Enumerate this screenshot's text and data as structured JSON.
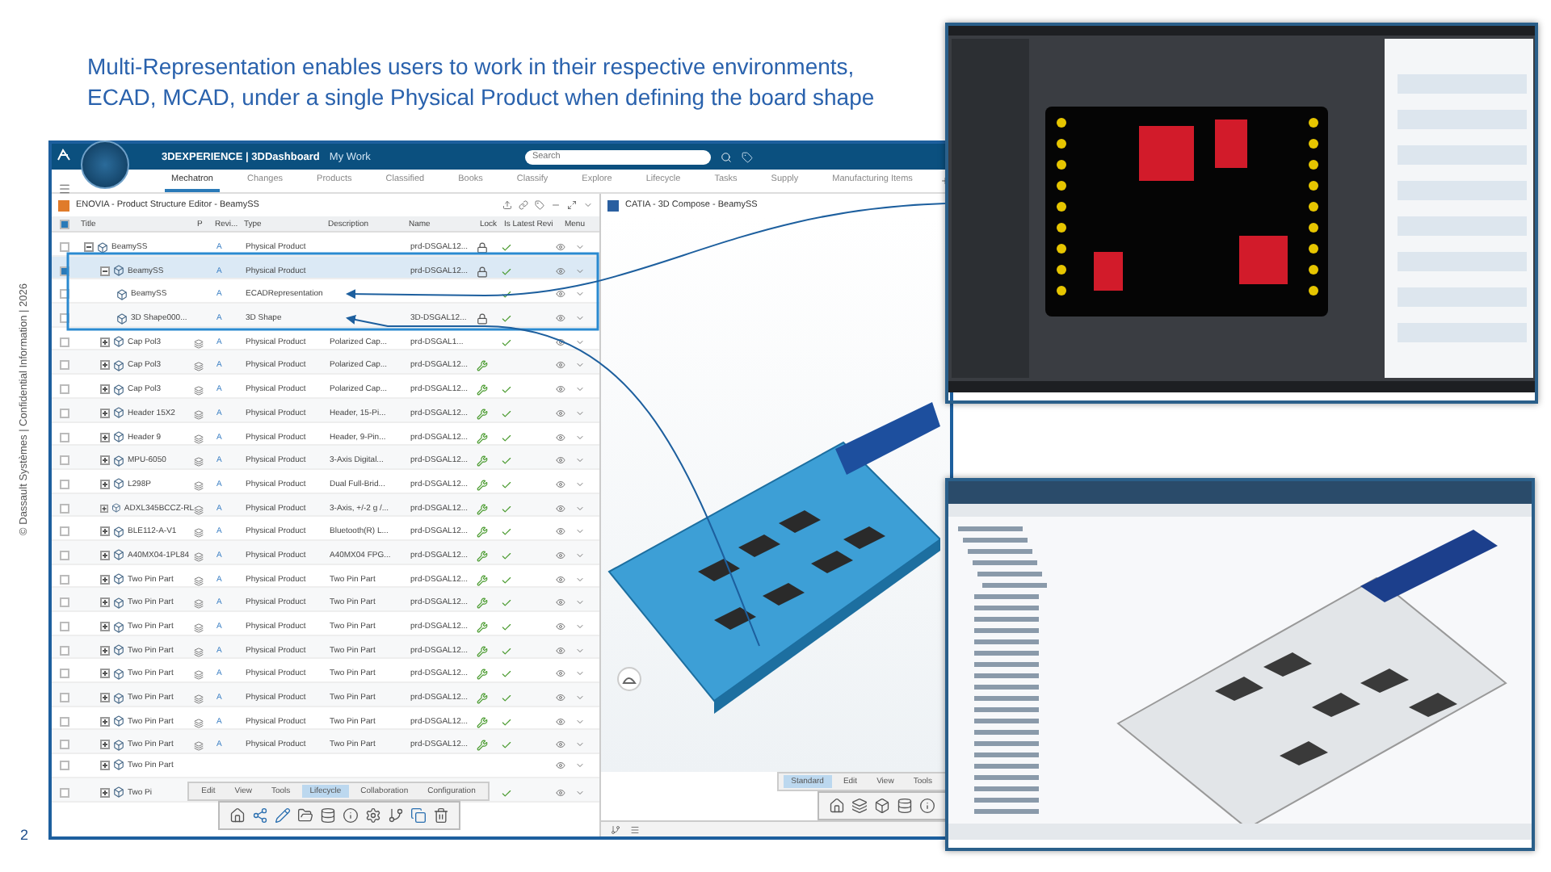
{
  "caption": "Multi-Representation enables users to work in their respective environments, ECAD, MCAD, under a single Physical Product when defining the board shape",
  "side_note": "© Dassault Systèmes | Confidential Information | 2026",
  "page_number": "2",
  "app": {
    "brand": "3DEXPERIENCE | 3DDashboard",
    "brand_sub": "My Work",
    "search": {
      "placeholder": "Search"
    },
    "tabs": [
      {
        "label": "Mechatron",
        "selected": true
      },
      {
        "label": "Changes",
        "selected": false
      },
      {
        "label": "Products",
        "selected": false
      },
      {
        "label": "Classified",
        "selected": false
      },
      {
        "label": "Books",
        "selected": false
      },
      {
        "label": "Classify",
        "selected": false
      },
      {
        "label": "Explore",
        "selected": false
      },
      {
        "label": "Lifecycle",
        "selected": false
      },
      {
        "label": "Tasks",
        "selected": false
      },
      {
        "label": "Supply",
        "selected": false
      },
      {
        "label": "Manufacturing Items",
        "selected": false
      }
    ]
  },
  "left_panel": {
    "title": "ENOVIA - Product Structure Editor - BeamySS",
    "select_all_checked": true,
    "columns": [
      "Title",
      "P",
      "Revi...",
      "Type",
      "Description",
      "Name",
      "Lock",
      "Is Latest Revi",
      "Menu"
    ],
    "rows": [
      {
        "title": "BeamySS",
        "rev": "A",
        "type": "Physical Product",
        "name": "prd-DSGAL12...",
        "locked": true,
        "reserved": false,
        "latest": true,
        "checked": false,
        "selected": false,
        "expanded": true,
        "children": [
          {
            "title": "BeamySS",
            "rev": "A",
            "type": "Physical Product",
            "name": "prd-DSGAL12...",
            "locked": true,
            "reserved": false,
            "latest": true,
            "checked": true,
            "selected": true,
            "expanded": true,
            "children": [
              {
                "title": "BeamySS",
                "rev": "A",
                "type": "ECADRepresentation",
                "locked": false,
                "reserved": false,
                "latest": true,
                "checked": false,
                "selected": false
              },
              {
                "title": "3D Shape000...",
                "rev": "A",
                "type": "3D Shape",
                "name": "3D-DSGAL12...",
                "locked": true,
                "reserved": false,
                "latest": true,
                "checked": false,
                "selected": false
              }
            ]
          },
          {
            "title": "Cap Pol3",
            "rev": "A",
            "type": "Physical Product",
            "description": "Polarized Cap...",
            "name": "prd-DSGAL1...",
            "locked": false,
            "reserved": false,
            "latest": true,
            "checked": false,
            "selected": false,
            "expanded": false
          },
          {
            "title": "Cap Pol3",
            "rev": "A",
            "type": "Physical Product",
            "description": "Polarized Cap...",
            "name": "prd-DSGAL12...",
            "locked": false,
            "reserved": true,
            "latest": false,
            "checked": false,
            "selected": false,
            "expanded": false
          },
          {
            "title": "Cap Pol3",
            "rev": "A",
            "type": "Physical Product",
            "description": "Polarized Cap...",
            "name": "prd-DSGAL12...",
            "locked": false,
            "reserved": true,
            "latest": true,
            "checked": false,
            "selected": false,
            "expanded": false
          },
          {
            "title": "Header 15X2",
            "rev": "A",
            "type": "Physical Product",
            "description": "Header, 15-Pi...",
            "name": "prd-DSGAL12...",
            "locked": false,
            "reserved": true,
            "latest": true,
            "checked": false,
            "selected": false,
            "expanded": false
          },
          {
            "title": "Header 9",
            "rev": "A",
            "type": "Physical Product",
            "description": "Header, 9-Pin...",
            "name": "prd-DSGAL12...",
            "locked": false,
            "reserved": true,
            "latest": true,
            "checked": false,
            "selected": false,
            "expanded": false
          },
          {
            "title": "MPU-6050",
            "rev": "A",
            "type": "Physical Product",
            "description": "3-Axis Digital...",
            "name": "prd-DSGAL12...",
            "locked": false,
            "reserved": true,
            "latest": true,
            "checked": false,
            "selected": false,
            "expanded": false
          },
          {
            "title": "L298P",
            "rev": "A",
            "type": "Physical Product",
            "description": "Dual Full-Brid...",
            "name": "prd-DSGAL12...",
            "locked": false,
            "reserved": true,
            "latest": true,
            "checked": false,
            "selected": false,
            "expanded": false
          },
          {
            "title": "ADXL345BCCZ-RL",
            "rev": "A",
            "type": "Physical Product",
            "description": "3-Axis, +/-2 g /...",
            "name": "prd-DSGAL12...",
            "locked": false,
            "reserved": true,
            "latest": true,
            "checked": false,
            "selected": false,
            "expanded": false
          },
          {
            "title": "BLE112-A-V1",
            "rev": "A",
            "type": "Physical Product",
            "description": "Bluetooth(R) L...",
            "name": "prd-DSGAL12...",
            "locked": false,
            "reserved": true,
            "latest": true,
            "checked": false,
            "selected": false,
            "expanded": false
          },
          {
            "title": "A40MX04-1PL84",
            "rev": "A",
            "type": "Physical Product",
            "description": "A40MX04 FPG...",
            "name": "prd-DSGAL12...",
            "locked": false,
            "reserved": true,
            "latest": true,
            "checked": false,
            "selected": false,
            "expanded": false
          },
          {
            "title": "Two Pin Part",
            "rev": "A",
            "type": "Physical Product",
            "description": "Two Pin Part",
            "name": "prd-DSGAL12...",
            "locked": false,
            "reserved": true,
            "latest": true,
            "checked": false,
            "selected": false,
            "expanded": false
          },
          {
            "title": "Two Pin Part",
            "rev": "A",
            "type": "Physical Product",
            "description": "Two Pin Part",
            "name": "prd-DSGAL12...",
            "locked": false,
            "reserved": true,
            "latest": true,
            "checked": false,
            "selected": false,
            "expanded": false
          },
          {
            "title": "Two Pin Part",
            "rev": "A",
            "type": "Physical Product",
            "description": "Two Pin Part",
            "name": "prd-DSGAL12...",
            "locked": false,
            "reserved": true,
            "latest": true,
            "checked": false,
            "selected": false,
            "expanded": false
          },
          {
            "title": "Two Pin Part",
            "rev": "A",
            "type": "Physical Product",
            "description": "Two Pin Part",
            "name": "prd-DSGAL12...",
            "locked": false,
            "reserved": true,
            "latest": true,
            "checked": false,
            "selected": false,
            "expanded": false
          },
          {
            "title": "Two Pin Part",
            "rev": "A",
            "type": "Physical Product",
            "description": "Two Pin Part",
            "name": "prd-DSGAL12...",
            "locked": false,
            "reserved": true,
            "latest": true,
            "checked": false,
            "selected": false,
            "expanded": false
          },
          {
            "title": "Two Pin Part",
            "rev": "A",
            "type": "Physical Product",
            "description": "Two Pin Part",
            "name": "prd-DSGAL12...",
            "locked": false,
            "reserved": true,
            "latest": true,
            "checked": false,
            "selected": false,
            "expanded": false
          },
          {
            "title": "Two Pin Part",
            "rev": "A",
            "type": "Physical Product",
            "description": "Two Pin Part",
            "name": "prd-DSGAL12...",
            "locked": false,
            "reserved": true,
            "latest": true,
            "checked": false,
            "selected": false,
            "expanded": false
          },
          {
            "title": "Two Pin Part",
            "rev": "A",
            "type": "Physical Product",
            "description": "Two Pin Part",
            "name": "prd-DSGAL12...",
            "locked": false,
            "reserved": true,
            "latest": true,
            "checked": false,
            "selected": false,
            "expanded": false
          },
          {
            "title": "Two Pin Part",
            "locked": false,
            "reserved": false,
            "latest": false,
            "checked": false,
            "selected": false,
            "expanded": false
          },
          {
            "title": "Two Pi",
            "locked": false,
            "reserved": false,
            "latest": true,
            "checked": false,
            "selected": false,
            "expanded": false
          }
        ]
      }
    ]
  },
  "toolbar": {
    "tabs": [
      {
        "label": "Edit",
        "selected": false
      },
      {
        "label": "View",
        "selected": false
      },
      {
        "label": "Tools",
        "selected": false
      },
      {
        "label": "Lifecycle",
        "selected": true
      },
      {
        "label": "Collaboration",
        "selected": false
      },
      {
        "label": "Configuration",
        "selected": false
      }
    ]
  },
  "right_panel": {
    "title": "CATIA - 3D Compose - BeamySS",
    "toolbar_tabs": [
      {
        "label": "Standard",
        "selected": true
      },
      {
        "label": "Edit",
        "selected": false
      },
      {
        "label": "View",
        "selected": false
      },
      {
        "label": "Tools",
        "selected": false
      }
    ]
  }
}
